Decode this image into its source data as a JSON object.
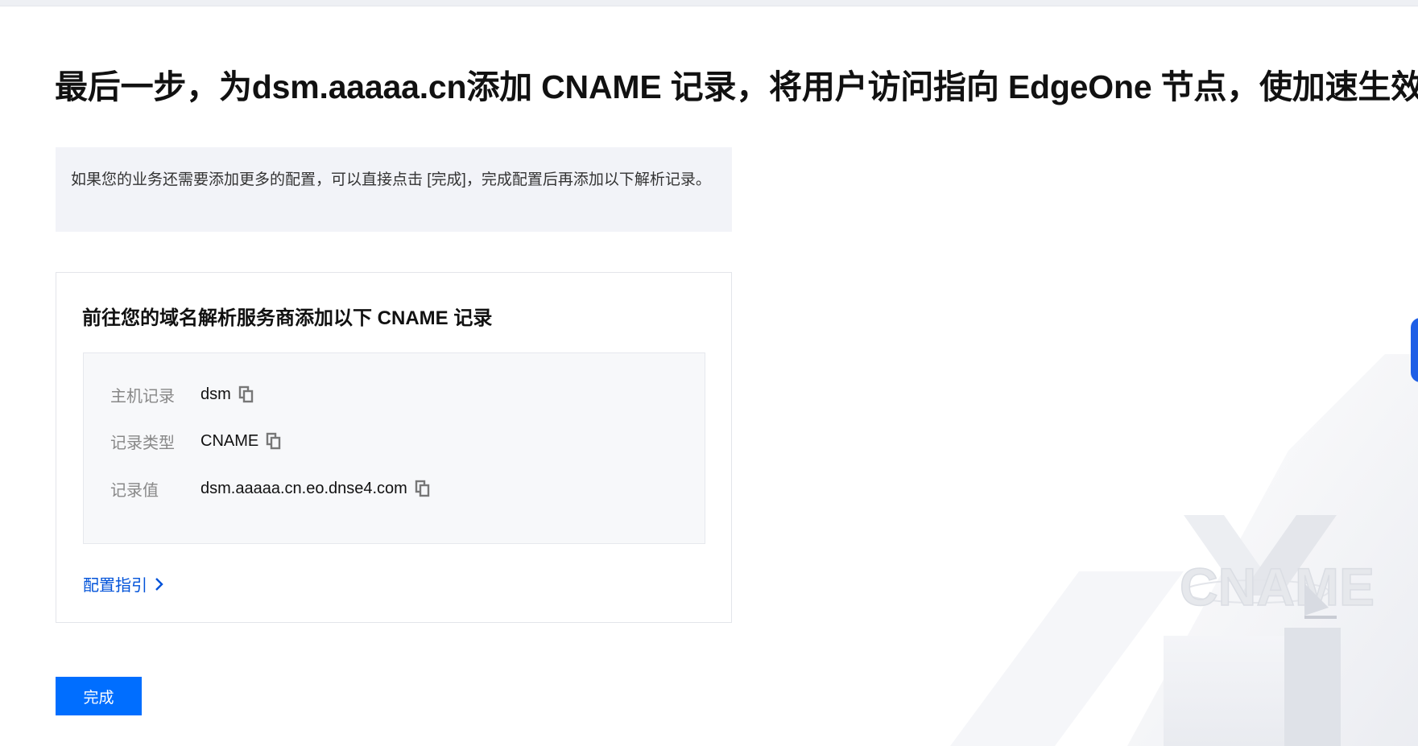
{
  "page": {
    "title": "最后一步，为dsm.aaaaa.cn添加 CNAME 记录，将用户访问指向 EdgeOne 节点，使加速生效"
  },
  "notice": {
    "text": "如果您的业务还需要添加更多的配置，可以直接点击 [完成]，完成配置后再添加以下解析记录。"
  },
  "card": {
    "title": "前往您的域名解析服务商添加以下 CNAME 记录",
    "records": [
      {
        "label": "主机记录",
        "value": "dsm"
      },
      {
        "label": "记录类型",
        "value": "CNAME"
      },
      {
        "label": "记录值",
        "value": "dsm.aaaaa.cn.eo.dnse4.com"
      }
    ],
    "guide_link": "配置指引"
  },
  "actions": {
    "done_label": "完成"
  },
  "illustration": {
    "text": "CNAME"
  },
  "colors": {
    "primary": "#006eff",
    "link": "#0052d9",
    "notice_bg": "#f2f3f8"
  }
}
